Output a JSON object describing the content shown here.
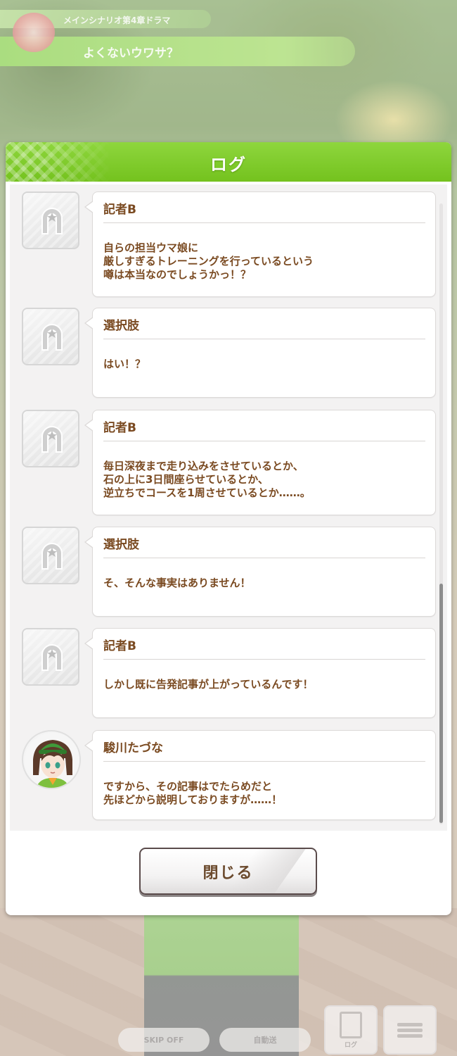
{
  "banner": {
    "subtitle": "メインシナリオ第4章ドラマ",
    "title": "よくないウワサ？"
  },
  "dialog": {
    "title": "ログ",
    "close_label": "閉じる"
  },
  "log": [
    {
      "speaker": "記者B",
      "text": "自らの担当ウマ娘に\n厳しすぎるトレーニングを行っているという\n噂は本当なのでしょうかっ！？",
      "avatar": "horseshoe-placeholder"
    },
    {
      "speaker": "選択肢",
      "text": "はい！？",
      "avatar": "horseshoe-placeholder"
    },
    {
      "speaker": "記者B",
      "text": "毎日深夜まで走り込みをさせているとか、\n石の上に3日間座らせているとか、\n逆立ちでコースを1周させているとか……。",
      "avatar": "horseshoe-placeholder"
    },
    {
      "speaker": "選択肢",
      "text": "そ、そんな事実はありません！",
      "avatar": "horseshoe-placeholder"
    },
    {
      "speaker": "記者B",
      "text": "しかし既に告発記事が上がっているんです！",
      "avatar": "horseshoe-placeholder"
    },
    {
      "speaker": "駿川たづな",
      "text": "ですから、その記事はでたらめだと\n先ほどから説明しておりますが……！",
      "avatar": "character-portrait"
    }
  ],
  "hud": {
    "skip_label": "SKIP OFF",
    "auto_label": "自動送",
    "log_caption": "ログ",
    "colors": {
      "accent": "#74c21e",
      "text_brown": "#7a4a21"
    }
  }
}
